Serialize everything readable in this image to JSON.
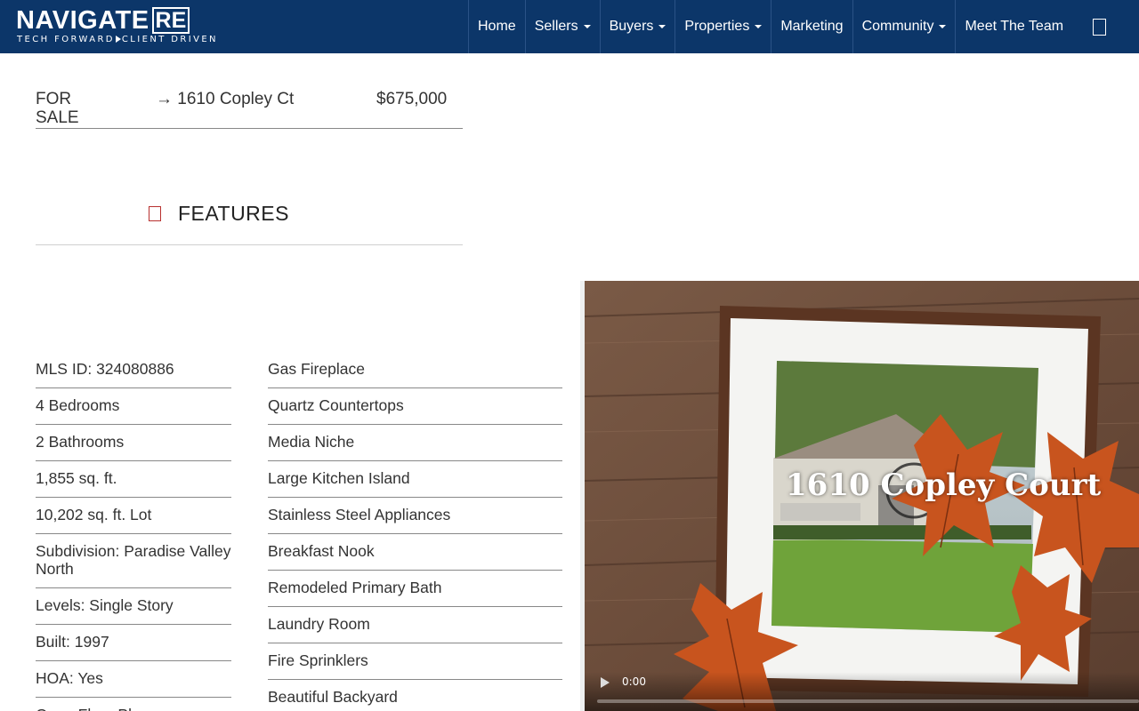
{
  "brand": {
    "name_main": "NAVIGATE",
    "name_suffix": "RE",
    "tagline_left": "TECH FORWARD",
    "tagline_right": "CLIENT DRIVEN",
    "bar_color": "#0c3669"
  },
  "nav": {
    "items": [
      {
        "label": "Home",
        "dropdown": false
      },
      {
        "label": "Sellers",
        "dropdown": true
      },
      {
        "label": "Buyers",
        "dropdown": true
      },
      {
        "label": "Properties",
        "dropdown": true
      },
      {
        "label": "Marketing",
        "dropdown": false
      },
      {
        "label": "Community",
        "dropdown": true
      },
      {
        "label": "Meet The Team",
        "dropdown": false
      }
    ],
    "icon": "phone-icon"
  },
  "listing": {
    "status": "FOR SALE",
    "address": "→ 1610 Copley Ct",
    "price": "$675,000"
  },
  "features": {
    "heading": "FEATURES",
    "icon": "document-icon",
    "icon_color": "#b8312f",
    "details": [
      "MLS ID: 324080886",
      "4 Bedrooms",
      "2 Bathrooms",
      "1,855 sq. ft.",
      "10,202 sq. ft. Lot",
      "Subdivision: Paradise Valley North",
      "Levels: Single Story",
      "Built: 1997",
      "HOA: Yes",
      "Open Floor Plan"
    ],
    "amenities": [
      "Gas Fireplace",
      "Quartz Countertops",
      "Media Niche",
      "Large Kitchen Island",
      "Stainless Steel Appliances",
      "Breakfast Nook",
      "Remodeled Primary Bath",
      "Laundry Room",
      "Fire Sprinklers",
      "Beautiful Backyard"
    ]
  },
  "video": {
    "caption": "1610 Copley Court",
    "time": "0:00"
  }
}
